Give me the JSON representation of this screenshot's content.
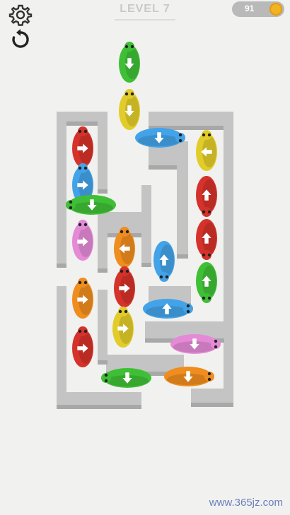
{
  "hud": {
    "level_label": "LEVEL 7",
    "coin_count": "91",
    "settings_icon": "gear-icon",
    "restart_icon": "restart-icon",
    "coin_icon": "coin-icon"
  },
  "colors": {
    "background": "#f1f1ef",
    "wall_top": "#c4c4c4",
    "wall_side": "#a8a8a8",
    "red": "#d4322a",
    "green": "#3fbf36",
    "yellow": "#e2cc2a",
    "blue": "#43a3e8",
    "pink": "#e48ad6",
    "orange": "#ef8d1e",
    "arrow": "#ffffff"
  },
  "board": {
    "wall_count": "maze",
    "pieces": [
      {
        "id": "green-top",
        "color": "green",
        "direction": "down",
        "orientation": "vertical"
      },
      {
        "id": "yellow-top",
        "color": "yellow",
        "direction": "down",
        "orientation": "vertical"
      },
      {
        "id": "blue-horizontal-top",
        "color": "blue",
        "direction": "down",
        "orientation": "horizontal"
      },
      {
        "id": "red-left-top",
        "color": "red",
        "direction": "right",
        "orientation": "vertical"
      },
      {
        "id": "blue-left",
        "color": "blue",
        "direction": "right",
        "orientation": "vertical"
      },
      {
        "id": "green-left",
        "color": "green",
        "direction": "down",
        "orientation": "horizontal"
      },
      {
        "id": "pink-left",
        "color": "pink",
        "direction": "right",
        "orientation": "vertical"
      },
      {
        "id": "orange-center",
        "color": "orange",
        "direction": "left",
        "orientation": "vertical"
      },
      {
        "id": "red-center",
        "color": "red",
        "direction": "right",
        "orientation": "vertical"
      },
      {
        "id": "yellow-center",
        "color": "yellow",
        "direction": "right",
        "orientation": "vertical"
      },
      {
        "id": "blue-center-vertical",
        "color": "blue",
        "direction": "up",
        "orientation": "vertical"
      },
      {
        "id": "blue-center-horizontal",
        "color": "blue",
        "direction": "up",
        "orientation": "horizontal"
      },
      {
        "id": "yellow-right",
        "color": "yellow",
        "direction": "left",
        "orientation": "vertical"
      },
      {
        "id": "red-right-1",
        "color": "red",
        "direction": "up",
        "orientation": "vertical"
      },
      {
        "id": "red-right-2",
        "color": "red",
        "direction": "up",
        "orientation": "vertical"
      },
      {
        "id": "green-right",
        "color": "green",
        "direction": "up",
        "orientation": "vertical"
      },
      {
        "id": "orange-left",
        "color": "orange",
        "direction": "right",
        "orientation": "vertical"
      },
      {
        "id": "red-left-bottom",
        "color": "red",
        "direction": "right",
        "orientation": "vertical"
      },
      {
        "id": "pink-right",
        "color": "pink",
        "direction": "down",
        "orientation": "horizontal"
      },
      {
        "id": "green-bottom",
        "color": "green",
        "direction": "down",
        "orientation": "horizontal"
      },
      {
        "id": "orange-bottom",
        "color": "orange",
        "direction": "down",
        "orientation": "horizontal"
      }
    ]
  },
  "watermark": "www.365jz.com"
}
